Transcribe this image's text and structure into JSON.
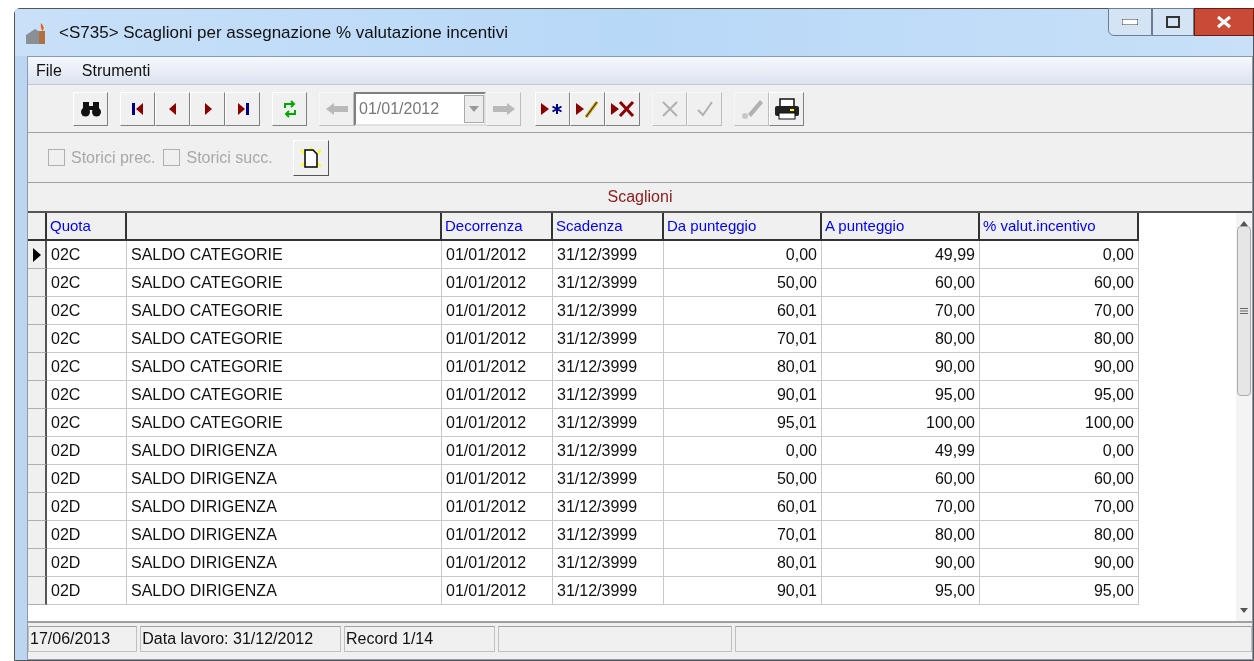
{
  "window": {
    "title": "<S735> Scaglioni per assegnazione % valutazione incentivi"
  },
  "menu": [
    {
      "label": "File"
    },
    {
      "label": "Strumenti"
    }
  ],
  "toolbar": {
    "buttons": [
      {
        "disabled": false
      },
      {
        "disabled": false
      },
      {
        "disabled": false
      },
      {
        "disabled": false
      },
      {
        "disabled": false
      },
      {
        "disabled": false
      }
    ],
    "date_picker": {
      "value": "01/01/2012",
      "prev_disabled": true,
      "next_disabled": true
    },
    "edit_buttons": [
      {
        "disabled": false
      },
      {
        "disabled": false
      },
      {
        "disabled": false
      },
      {
        "disabled": true
      },
      {
        "disabled": true
      },
      {
        "disabled": true
      },
      {
        "disabled": false
      }
    ]
  },
  "options": [
    {
      "label": "Storici prec.",
      "checked": false,
      "disabled": true
    },
    {
      "label": "Storici succ.",
      "checked": false,
      "disabled": true
    }
  ],
  "section_title": "Scaglioni",
  "table": {
    "columns": [
      "Quota",
      "",
      "Decorrenza",
      "Scadenza",
      "Da punteggio",
      "A punteggio",
      "% valut.incentivo"
    ],
    "rows": [
      {
        "selected": true,
        "cells": [
          "02C",
          "SALDO CATEGORIE",
          "01/01/2012",
          "31/12/3999",
          "0,00",
          "49,99",
          "0,00"
        ]
      },
      {
        "selected": false,
        "cells": [
          "02C",
          "SALDO CATEGORIE",
          "01/01/2012",
          "31/12/3999",
          "50,00",
          "60,00",
          "60,00"
        ]
      },
      {
        "selected": false,
        "cells": [
          "02C",
          "SALDO CATEGORIE",
          "01/01/2012",
          "31/12/3999",
          "60,01",
          "70,00",
          "70,00"
        ]
      },
      {
        "selected": false,
        "cells": [
          "02C",
          "SALDO CATEGORIE",
          "01/01/2012",
          "31/12/3999",
          "70,01",
          "80,00",
          "80,00"
        ]
      },
      {
        "selected": false,
        "cells": [
          "02C",
          "SALDO CATEGORIE",
          "01/01/2012",
          "31/12/3999",
          "80,01",
          "90,00",
          "90,00"
        ]
      },
      {
        "selected": false,
        "cells": [
          "02C",
          "SALDO CATEGORIE",
          "01/01/2012",
          "31/12/3999",
          "90,01",
          "95,00",
          "95,00"
        ]
      },
      {
        "selected": false,
        "cells": [
          "02C",
          "SALDO CATEGORIE",
          "01/01/2012",
          "31/12/3999",
          "95,01",
          "100,00",
          "100,00"
        ]
      },
      {
        "selected": false,
        "cells": [
          "02D",
          "SALDO DIRIGENZA",
          "01/01/2012",
          "31/12/3999",
          "0,00",
          "49,99",
          "0,00"
        ]
      },
      {
        "selected": false,
        "cells": [
          "02D",
          "SALDO DIRIGENZA",
          "01/01/2012",
          "31/12/3999",
          "50,00",
          "60,00",
          "60,00"
        ]
      },
      {
        "selected": false,
        "cells": [
          "02D",
          "SALDO DIRIGENZA",
          "01/01/2012",
          "31/12/3999",
          "60,01",
          "70,00",
          "70,00"
        ]
      },
      {
        "selected": false,
        "cells": [
          "02D",
          "SALDO DIRIGENZA",
          "01/01/2012",
          "31/12/3999",
          "70,01",
          "80,00",
          "80,00"
        ]
      },
      {
        "selected": false,
        "cells": [
          "02D",
          "SALDO DIRIGENZA",
          "01/01/2012",
          "31/12/3999",
          "80,01",
          "90,00",
          "90,00"
        ]
      },
      {
        "selected": false,
        "cells": [
          "02D",
          "SALDO DIRIGENZA",
          "01/01/2012",
          "31/12/3999",
          "90,01",
          "95,00",
          "95,00"
        ]
      }
    ]
  },
  "status_bar": [
    "17/06/2013",
    "Data lavoro: 31/12/2012",
    "Record 1/14"
  ]
}
